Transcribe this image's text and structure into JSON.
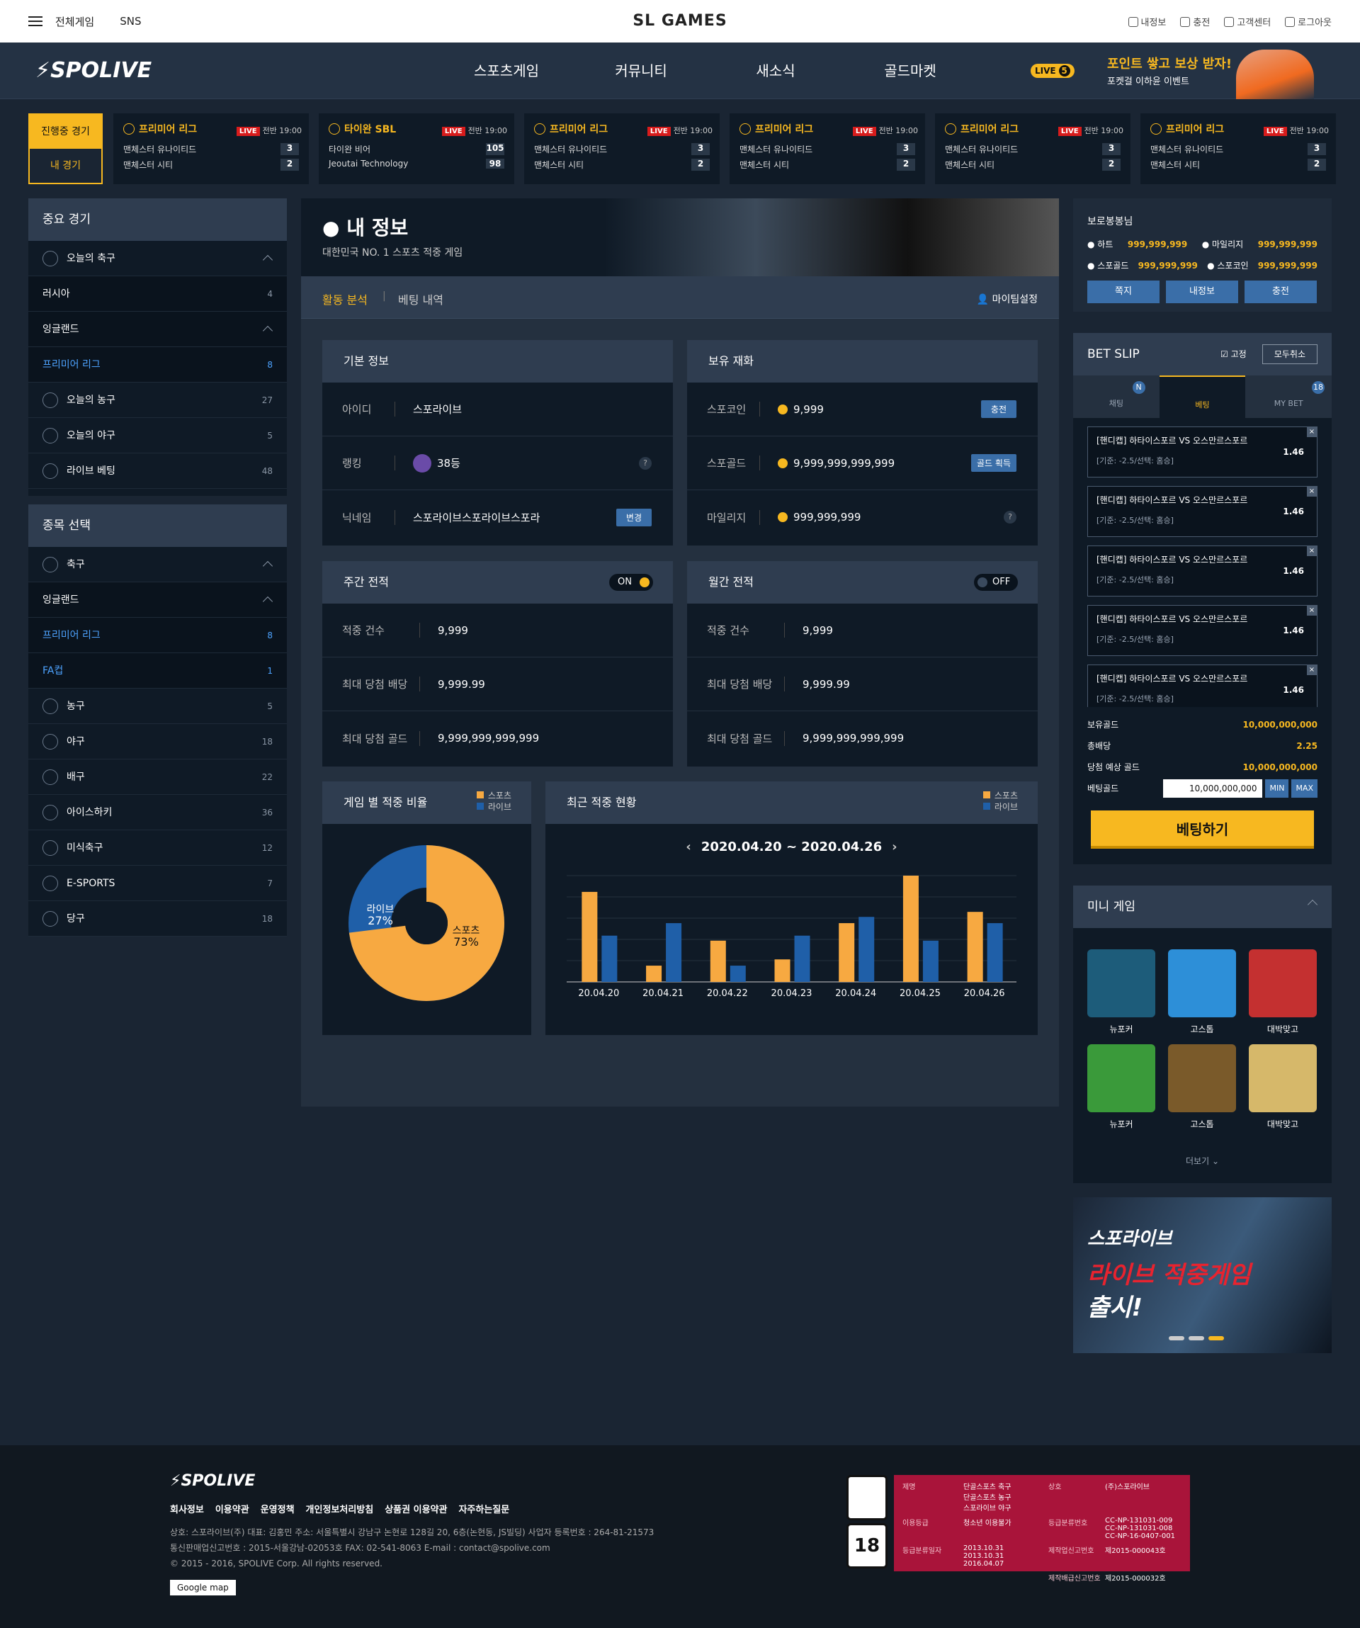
{
  "topbar": {
    "all_games": "전체게임",
    "sns": "SNS",
    "brand": "SL GAMES",
    "links": [
      "내정보",
      "충전",
      "고객센터",
      "로그아웃"
    ]
  },
  "nav": {
    "logo": "SPOLIVE",
    "menu": [
      "스포츠게임",
      "커뮤니티",
      "새소식",
      "골드마켓"
    ],
    "live_badge": "LIVE",
    "live_count": "5",
    "promo_title": "포인트 쌓고 보상 받자!",
    "promo_sub": "포켓걸 이하윤 이벤트"
  },
  "strip": {
    "tab_live": "진행중 경기",
    "tab_mine": "내 경기",
    "matches": [
      {
        "league": "프리미어 리그",
        "live": "LIVE",
        "time": "전반 19:00",
        "t1": "맨체스터 유나이티드",
        "s1": "3",
        "t2": "맨체스터 시티",
        "s2": "2"
      },
      {
        "league": "타이완 SBL",
        "live": "LIVE",
        "time": "전반 19:00",
        "t1": "타이완 비어",
        "s1": "105",
        "t2": "Jeoutai Technology",
        "s2": "98"
      },
      {
        "league": "프리미어 리그",
        "live": "LIVE",
        "time": "전반 19:00",
        "t1": "맨체스터 유나이티드",
        "s1": "3",
        "t2": "맨체스터 시티",
        "s2": "2"
      },
      {
        "league": "프리미어 리그",
        "live": "LIVE",
        "time": "전반 19:00",
        "t1": "맨체스터 유나이티드",
        "s1": "3",
        "t2": "맨체스터 시티",
        "s2": "2"
      },
      {
        "league": "프리미어 리그",
        "live": "LIVE",
        "time": "전반 19:00",
        "t1": "맨체스터 유나이티드",
        "s1": "3",
        "t2": "맨체스터 시티",
        "s2": "2"
      },
      {
        "league": "프리미어 리그",
        "live": "LIVE",
        "time": "전반 19:00",
        "t1": "맨체스터 유나이티드",
        "s1": "3",
        "t2": "맨체스터 시티",
        "s2": "2"
      }
    ]
  },
  "left1": {
    "title": "중요 경기",
    "rows": [
      {
        "label": "오늘의 축구",
        "count": "",
        "type": "main"
      },
      {
        "label": "러시아",
        "count": "4",
        "type": "sub"
      },
      {
        "label": "잉글랜드",
        "count": "",
        "type": "sub"
      },
      {
        "label": "프리미어 리그",
        "count": "8",
        "type": "sel"
      },
      {
        "label": "오늘의 농구",
        "count": "27",
        "type": "main"
      },
      {
        "label": "오늘의 야구",
        "count": "5",
        "type": "main"
      },
      {
        "label": "라이브 베팅",
        "count": "48",
        "type": "main"
      }
    ]
  },
  "left2": {
    "title": "종목 선택",
    "rows": [
      {
        "label": "축구",
        "count": "",
        "type": "main"
      },
      {
        "label": "잉글랜드",
        "count": "",
        "type": "sub"
      },
      {
        "label": "프리미어 리그",
        "count": "8",
        "type": "sel"
      },
      {
        "label": "FA컵",
        "count": "1",
        "type": "sel"
      },
      {
        "label": "농구",
        "count": "5",
        "type": "main"
      },
      {
        "label": "야구",
        "count": "18",
        "type": "main"
      },
      {
        "label": "배구",
        "count": "22",
        "type": "main"
      },
      {
        "label": "아이스하키",
        "count": "36",
        "type": "main"
      },
      {
        "label": "미식축구",
        "count": "12",
        "type": "main"
      },
      {
        "label": "E-SPORTS",
        "count": "7",
        "type": "main"
      },
      {
        "label": "당구",
        "count": "18",
        "type": "main"
      }
    ]
  },
  "hero": {
    "title": "내 정보",
    "sub": "대한민국 NO. 1 스포츠 적중 게임"
  },
  "subtabs": {
    "a": "활동 분석",
    "b": "베팅 내역",
    "c": "마이팀설정"
  },
  "basic": {
    "title": "기본 정보",
    "id_k": "아이디",
    "id_v": "스포라이브",
    "rank_k": "랭킹",
    "rank_v": "38등",
    "nick_k": "닉네임",
    "nick_v": "스포라이브스포라이브스포라",
    "change": "변경"
  },
  "wallet": {
    "title": "보유 재화",
    "r1k": "스포코인",
    "r1v": "9,999",
    "r1b": "충전",
    "r2k": "스포골드",
    "r2v": "9,999,999,999,999",
    "r2b": "골드 획득",
    "r3k": "마일리지",
    "r3v": "999,999,999"
  },
  "weekly": {
    "title": "주간 전적",
    "toggle": "ON",
    "r1k": "적중 건수",
    "r1v": "9,999",
    "r2k": "최대 당첨 배당",
    "r2v": "9,999.99",
    "r3k": "최대 당첨 골드",
    "r3v": "9,999,999,999,999"
  },
  "monthly": {
    "title": "월간 전적",
    "toggle": "OFF",
    "r1k": "적중 건수",
    "r1v": "9,999",
    "r2k": "최대 당첨 배당",
    "r2v": "9,999.99",
    "r3k": "최대 당첨 골드",
    "r3v": "9,999,999,999,999"
  },
  "pie": {
    "title": "게임 별 적중 비율",
    "legend": [
      "스포츠",
      "라이브"
    ],
    "sports_label": "스포츠",
    "sports_pct": "73%",
    "live_label": "라이브",
    "live_pct": "27%"
  },
  "recent": {
    "title": "최근 적중 현황",
    "range": "2020.04.20 ~ 2020.04.26",
    "legend": [
      "스포츠",
      "라이브"
    ]
  },
  "chart_data": {
    "type": "bar",
    "categories": [
      "20.04.20",
      "20.04.21",
      "20.04.22",
      "20.04.23",
      "20.04.24",
      "20.04.25",
      "20.04.26"
    ],
    "series": [
      {
        "name": "스포츠",
        "values": [
          72,
          13,
          33,
          18,
          47,
          85,
          56
        ]
      },
      {
        "name": "라이브",
        "values": [
          37,
          47,
          13,
          37,
          52,
          33,
          47
        ]
      }
    ],
    "ylim": [
      0,
      85
    ],
    "colors": [
      "#f7a941",
      "#1f5fa8"
    ]
  },
  "wallet_top": {
    "title": "보로봉봉님",
    "hearts_k": "하트",
    "hearts_v": "999,999,999",
    "mile_k": "마일리지",
    "mile_v": "999,999,999",
    "gold_k": "스포골드",
    "gold_v": "999,999,999",
    "coin_k": "스포코인",
    "coin_v": "999,999,999",
    "btns": [
      "쪽지",
      "내정보",
      "충전"
    ]
  },
  "betslip": {
    "title": "BET SLIP",
    "fix": "고정",
    "clear": "모두취소",
    "tabs": [
      "채팅",
      "베팅",
      "MY BET"
    ],
    "badge_n": "N",
    "badge_18": "18",
    "items": [
      {
        "t": "[핸디캡] 하타이스포르 VS 오스만르스포르",
        "s": "[기준: -2.5/선택: 홈승]",
        "o": "1.46"
      },
      {
        "t": "[핸디캡] 하타이스포르 VS 오스만르스포르",
        "s": "[기준: -2.5/선택: 홈승]",
        "o": "1.46"
      },
      {
        "t": "[핸디캡] 하타이스포르 VS 오스만르스포르",
        "s": "[기준: -2.5/선택: 홈승]",
        "o": "1.46"
      },
      {
        "t": "[핸디캡] 하타이스포르 VS 오스만르스포르",
        "s": "[기준: -2.5/선택: 홈승]",
        "o": "1.46"
      },
      {
        "t": "[핸디캡] 하타이스포르 VS 오스만르스포르",
        "s": "[기준: -2.5/선택: 홈승]",
        "o": "1.46"
      }
    ],
    "own_k": "보유골드",
    "own_v": "10,000,000,000",
    "odds_k": "총배당",
    "odds_v": "2.25",
    "exp_k": "당첨 예상 골드",
    "exp_v": "10,000,000,000",
    "bet_k": "베팅골드",
    "bet_v": "10,000,000,000",
    "min": "MIN",
    "max": "MAX",
    "submit": "베팅하기"
  },
  "mini": {
    "title": "미니 게임",
    "games": [
      "뉴포커",
      "고스톱",
      "대박맞고",
      "뉴포커",
      "고스톱",
      "대박맞고"
    ],
    "more": "더보기"
  },
  "banner": {
    "l1": "스포라이브",
    "l2": "라이브 적중게임",
    "l3": "출시!"
  },
  "footer": {
    "logo": "SPOLIVE",
    "links": [
      "회사정보",
      "이용약관",
      "운영정책",
      "개인정보처리방침",
      "상품권 이용약관",
      "자주하는질문"
    ],
    "l1": "상호: 스포라이브(주)   대표: 김홍민   주소: 서울특별시 강남구 논현로 128길 20, 6층(논현동, JS빌딩)   사업자 등록번호 : 264-81-21573",
    "l2": "통신판매업신고번호 : 2015-서울강남-02053호   FAX: 02-541-8063   E-mail : contact@spolive.com",
    "l3": "© 2015 - 2016, SPOLIVE Corp. All rights reserved.",
    "map": "Google map",
    "rating": {
      "k1": "제명",
      "v1": "단골스포츠 축구\n단골스포츠 농구\n스포라이브 야구",
      "k2": "이용등급",
      "v2": "청소년 이용불가",
      "k3": "등급분류일자",
      "v3": "2013.10.31\n2013.10.31\n2016.04.07",
      "k4": "상호",
      "v4": "(주)스포라이브",
      "k5": "등급분류번호",
      "v5": "CC-NP-131031-009\nCC-NP-131031-008\nCC-NP-16-0407-001",
      "k6": "제작업신고번호",
      "v6": "제2015-000043호",
      "k7": "제작배급신고번호",
      "v7": "제2015-000032호"
    }
  }
}
